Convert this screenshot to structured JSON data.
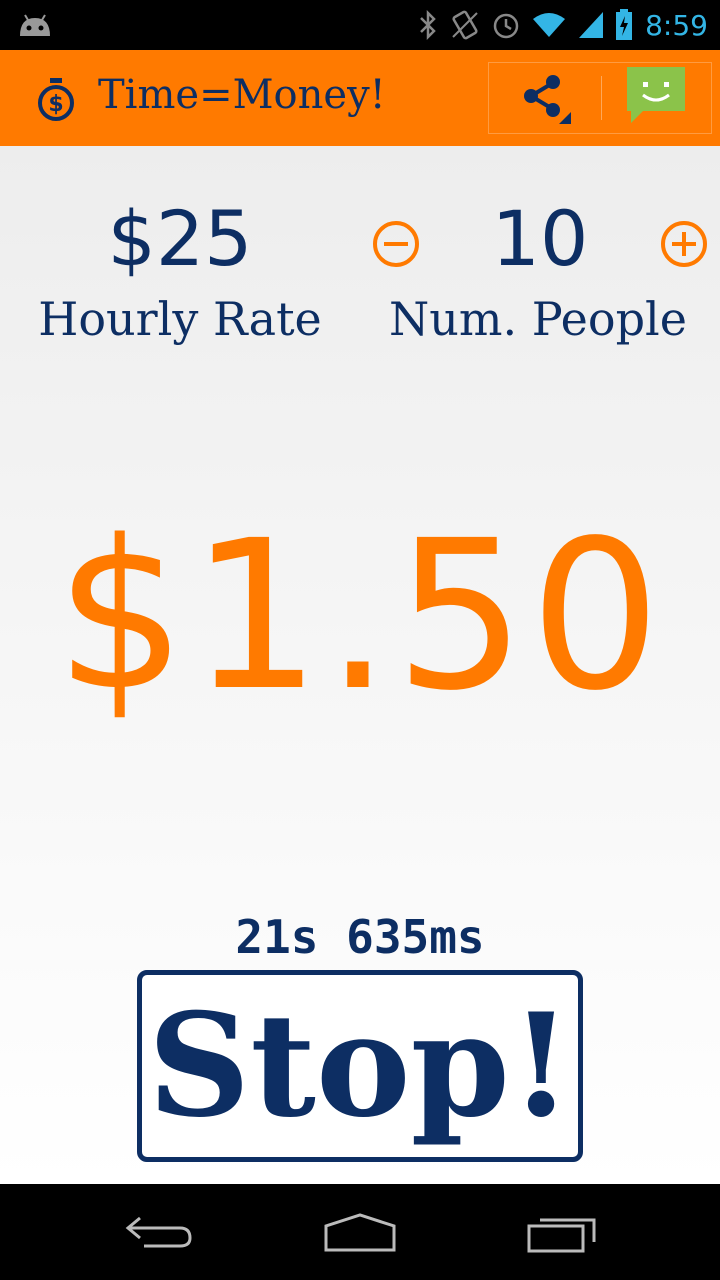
{
  "status_bar": {
    "time": "8:59",
    "icons": [
      "android-debug-icon",
      "bluetooth-icon",
      "vibrate-icon",
      "alarm-icon",
      "wifi-icon",
      "signal-icon",
      "battery-charging-icon"
    ],
    "accent": "#33b5e5"
  },
  "action_bar": {
    "title": "Time=Money!",
    "color": "#ff7a00",
    "icons": [
      "stopwatch-dollar-icon",
      "share-icon",
      "smiley-message-icon"
    ]
  },
  "inputs": {
    "hourly_rate_value": "$25",
    "hourly_rate_label": "Hourly Rate",
    "people_value": "10",
    "people_label": "Num. People"
  },
  "meter": {
    "cost": "$1.50",
    "elapsed": "21s 635ms"
  },
  "controls": {
    "stop_label": "Stop!"
  },
  "nav_bar": {
    "icons": [
      "back-icon",
      "home-icon",
      "recent-apps-icon"
    ]
  },
  "colors": {
    "orange": "#ff7a00",
    "navy": "#0d2e63"
  }
}
